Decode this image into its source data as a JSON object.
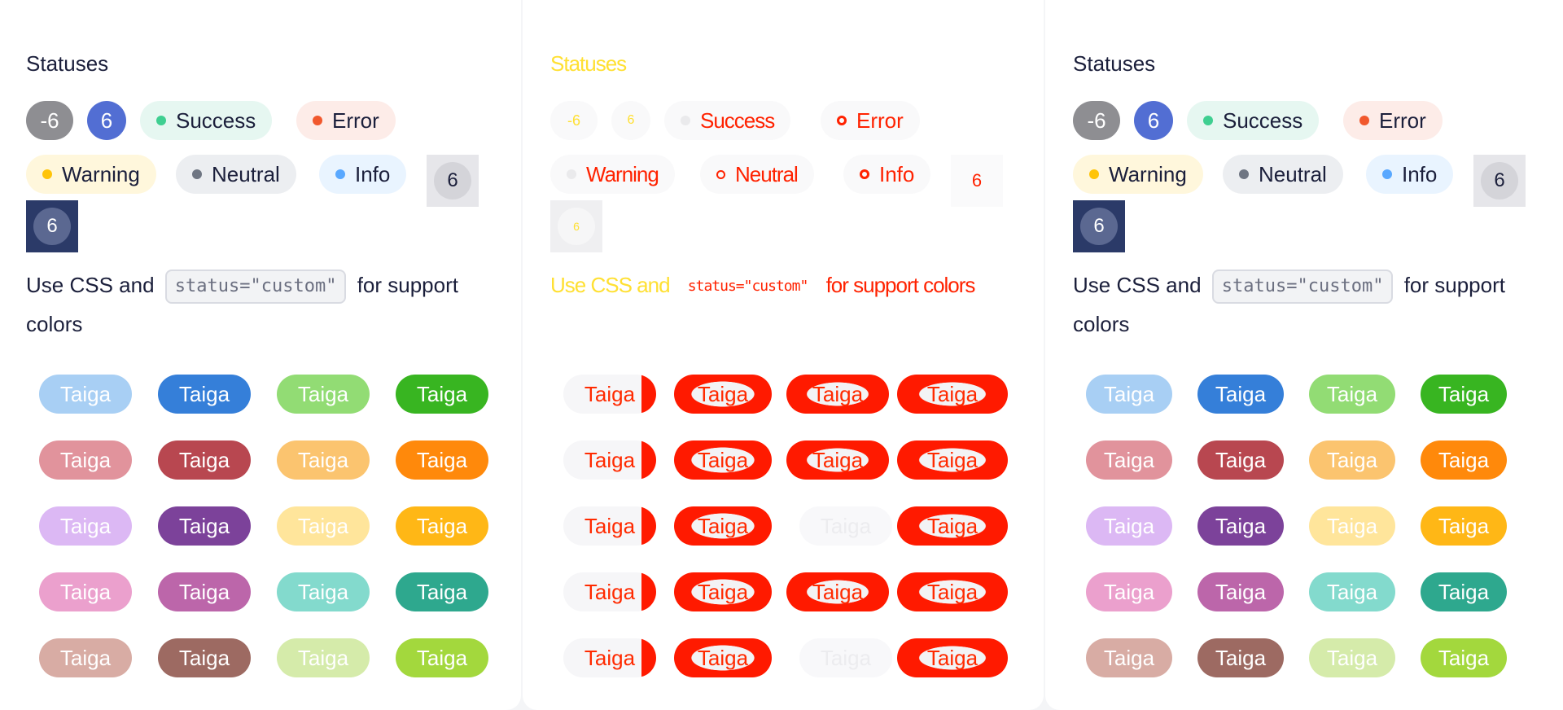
{
  "heading": "Statuses",
  "badges": {
    "negative": "-6",
    "count": "6",
    "success": "Success",
    "error": "Error",
    "warning": "Warning",
    "neutral": "Neutral",
    "info": "Info",
    "square1": "6",
    "square2": "6"
  },
  "text": {
    "before": "Use CSS and",
    "code": "status=\"custom\"",
    "after": "for support colors"
  },
  "pill_label": "Taiga",
  "colors": {
    "success_bg": "#e6f7f1",
    "success_dot": "#3fcf91",
    "error_bg": "#fdece8",
    "error_dot": "#f1582d",
    "warning_bg": "#fff7dc",
    "warning_dot": "#ffc409",
    "neutral_bg": "#eceef1",
    "neutral_dot": "#6f7683",
    "info_bg": "#e9f4ff",
    "info_dot": "#59a8ff",
    "negative_bg": "#8e8e92",
    "count_bg": "#526ed3",
    "square1_bg": "#e6e6ea",
    "square1_circle": "#d4d4d9",
    "square2_bg": "#2b3a68",
    "square2_circle": "#5b6891",
    "pills": [
      [
        "#a8cff4",
        "#357fd9",
        "#92dc74",
        "#38b521"
      ],
      [
        "#e1939c",
        "#b84750",
        "#fbc46f",
        "#ff890b"
      ],
      [
        "#dcb8f4",
        "#7c429a",
        "#ffe59b",
        "#ffb716"
      ],
      [
        "#eba0cd",
        "#bc66aa",
        "#83dacd",
        "#2ea88e"
      ],
      [
        "#d8aca4",
        "#9d6a62",
        "#d5ebaa",
        "#a3d83d"
      ]
    ]
  }
}
